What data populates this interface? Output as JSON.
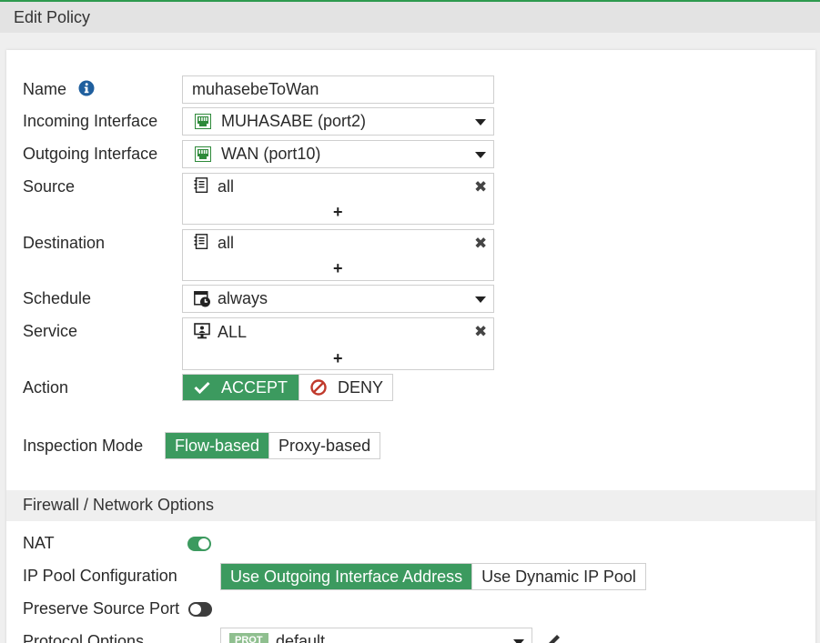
{
  "window": {
    "title": "Edit Policy"
  },
  "form": {
    "name": {
      "label": "Name",
      "value": "muhasebeToWan"
    },
    "incoming": {
      "label": "Incoming Interface",
      "value": "MUHASABE (port2)"
    },
    "outgoing": {
      "label": "Outgoing Interface",
      "value": "WAN (port10)"
    },
    "source": {
      "label": "Source",
      "value": "all",
      "add": "+"
    },
    "destination": {
      "label": "Destination",
      "value": "all",
      "add": "+"
    },
    "schedule": {
      "label": "Schedule",
      "value": "always"
    },
    "service": {
      "label": "Service",
      "value": "ALL",
      "add": "+"
    },
    "action": {
      "label": "Action",
      "accept": "ACCEPT",
      "deny": "DENY",
      "selected": "ACCEPT"
    },
    "inspection": {
      "label": "Inspection Mode",
      "options": [
        "Flow-based",
        "Proxy-based"
      ],
      "selected": "Flow-based"
    }
  },
  "firewall_options": {
    "heading": "Firewall / Network Options",
    "nat": {
      "label": "NAT",
      "enabled": true
    },
    "ip_pool": {
      "label": "IP Pool Configuration",
      "options": [
        "Use Outgoing Interface Address",
        "Use Dynamic IP Pool"
      ],
      "selected": "Use Outgoing Interface Address"
    },
    "preserve_port": {
      "label": "Preserve Source Port",
      "enabled": false
    },
    "protocol_options": {
      "label": "Protocol Options",
      "badge": "PROT",
      "value": "default"
    }
  },
  "colors": {
    "accent": "#3c9a5f",
    "info": "#1f5f9e",
    "deny": "#c0392b",
    "topline": "#2e9a4f"
  }
}
